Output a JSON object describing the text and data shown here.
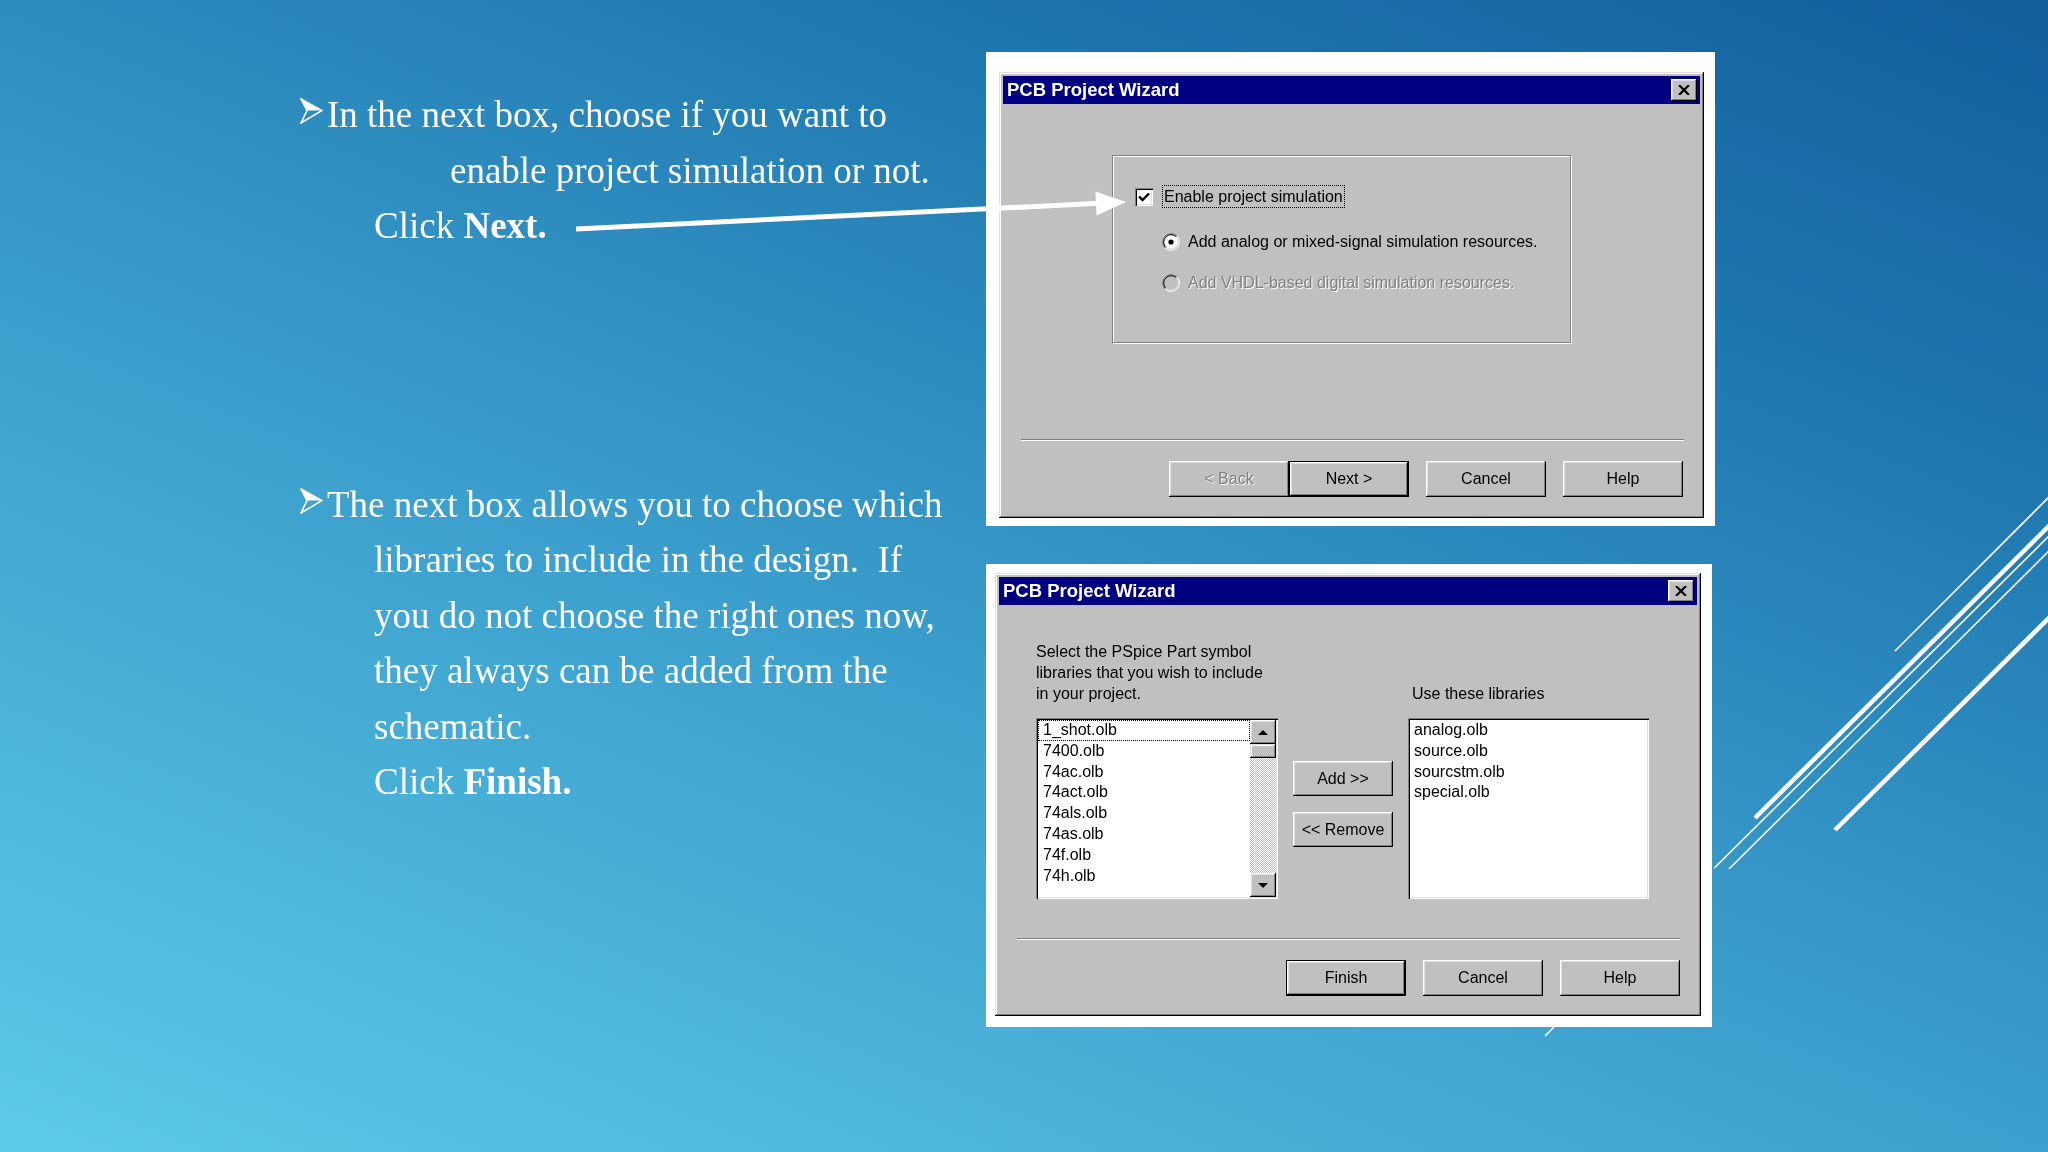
{
  "bullets": [
    {
      "lines": [
        "In the next box, choose if you want to",
        "enable project simulation or not."
      ],
      "action": "Click **Next.**"
    },
    {
      "lines": [
        "The next box allows you to choose which",
        "libraries to include in the design.  If",
        "you do not choose the right ones now,",
        "they always can be added from the",
        "schematic."
      ],
      "action": "Click **Finish.**"
    }
  ],
  "simulation_dialog": {
    "title": "PCB Project Wizard",
    "checkbox": {
      "label": "Enable project simulation",
      "checked": true,
      "focused": true
    },
    "options": [
      {
        "label": "Add analog or mixed-signal simulation resources.",
        "selected": true,
        "disabled": false
      },
      {
        "label": "Add VHDL-based digital simulation resources.",
        "selected": false,
        "disabled": true
      }
    ],
    "buttons": [
      {
        "label": "< Back",
        "default": false,
        "disabled": true
      },
      {
        "label": "Next >",
        "default": true,
        "disabled": false
      },
      {
        "label": "Cancel",
        "default": false,
        "disabled": false
      },
      {
        "label": "Help",
        "default": false,
        "disabled": false
      }
    ]
  },
  "libraries_dialog": {
    "title": "PCB Project Wizard",
    "instructions": [
      "Select the PSpice Part symbol",
      "libraries that you wish to include",
      "in your project."
    ],
    "selected_label": "Use these libraries",
    "available": [
      {
        "label": "1_shot.olb",
        "focused": true
      },
      {
        "label": "7400.olb",
        "focused": false
      },
      {
        "label": "74ac.olb",
        "focused": false
      },
      {
        "label": "74act.olb",
        "focused": false
      },
      {
        "label": "74als.olb",
        "focused": false
      },
      {
        "label": "74as.olb",
        "focused": false
      },
      {
        "label": "74f.olb",
        "focused": false
      },
      {
        "label": "74h.olb",
        "focused": false
      }
    ],
    "move_buttons": [
      {
        "label": "Add >>"
      },
      {
        "label": "<< Remove"
      }
    ],
    "selected_libraries": [
      {
        "label": "analog.olb"
      },
      {
        "label": "source.olb"
      },
      {
        "label": "sourcstm.olb"
      },
      {
        "label": "special.olb"
      }
    ],
    "buttons": [
      {
        "label": "Finish",
        "default": true,
        "disabled": false
      },
      {
        "label": "Cancel",
        "default": false,
        "disabled": false
      },
      {
        "label": "Help",
        "default": false,
        "disabled": false
      }
    ]
  }
}
